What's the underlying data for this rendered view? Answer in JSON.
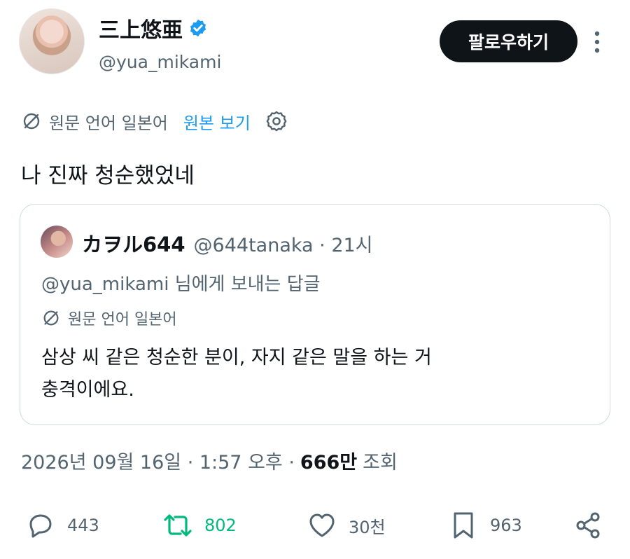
{
  "profile": {
    "display_name": "三上悠亜",
    "handle": "@yua_mikami",
    "follow_label": "팔로우하기"
  },
  "translation": {
    "source_language": "원문 언어 일본어",
    "view_original": "원본 보기"
  },
  "tweet": {
    "text": "나 진짜 청순했었네"
  },
  "quote": {
    "name": "カヲル644",
    "handle_time": "@644tanaka · 21시",
    "reply_to": "@yua_mikami 님에게 보내는 답글",
    "source_language": "원문 언어 일본어",
    "body_line1": "삼상 씨 같은 청순한 분이, 자지 같은 말을 하는 거",
    "body_line2": "충격이에요."
  },
  "meta": {
    "datetime": "2026년 09월 16일 · 1:57 오후 ·",
    "views_count": "666만",
    "views_label": "조회"
  },
  "actions": {
    "replies": "443",
    "retweets": "802",
    "likes": "30천",
    "bookmarks": "963"
  },
  "colors": {
    "accent": "#1d9bf0",
    "retweet": "#00ba7c",
    "muted": "#536471",
    "text": "#0f1419"
  },
  "icons": [
    "verified-icon",
    "more-icon",
    "translate-icon",
    "settings-icon",
    "reply-icon",
    "retweet-icon",
    "like-icon",
    "bookmark-icon",
    "share-icon"
  ]
}
